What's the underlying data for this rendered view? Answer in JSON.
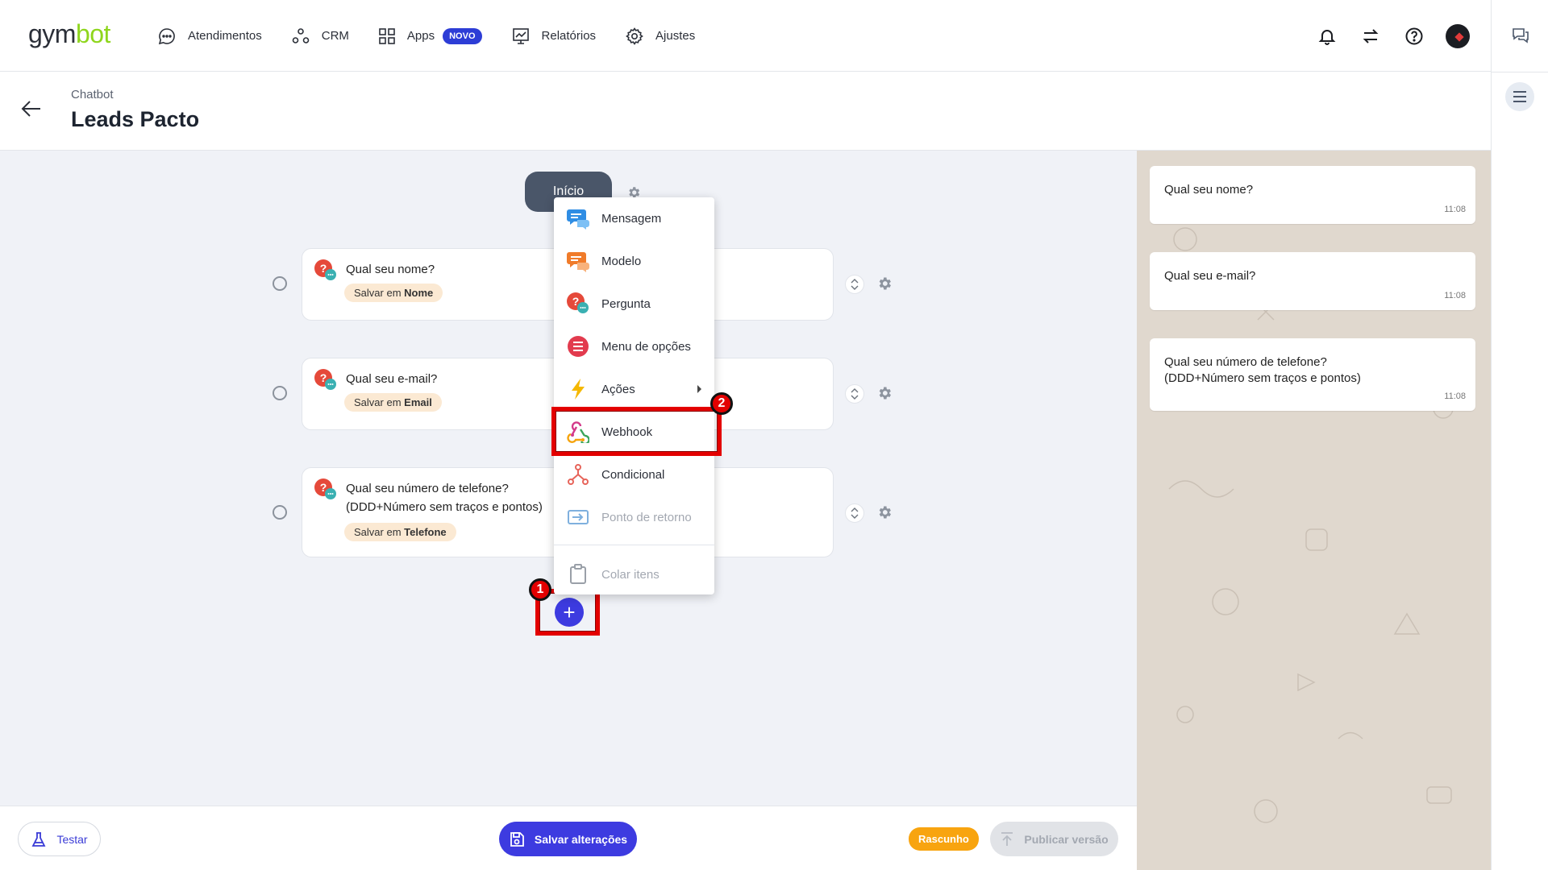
{
  "app": {
    "logo_gym": "gym",
    "logo_bot": "bot"
  },
  "nav": {
    "items": [
      {
        "label": "Atendimentos",
        "icon": "chat-bubble-icon"
      },
      {
        "label": "CRM",
        "icon": "crm-nodes-icon"
      },
      {
        "label": "Apps",
        "icon": "apps-grid-icon",
        "badge": "NOVO"
      },
      {
        "label": "Relatórios",
        "icon": "chart-board-icon"
      },
      {
        "label": "Ajustes",
        "icon": "gear-icon"
      }
    ]
  },
  "header": {
    "breadcrumb": "Chatbot",
    "title": "Leads Pacto"
  },
  "flow": {
    "start_label": "Início",
    "cards": [
      {
        "question": "Qual seu nome?",
        "save_prefix": "Salvar em",
        "save_field": "Nome"
      },
      {
        "question": "Qual seu e-mail?",
        "save_prefix": "Salvar em",
        "save_field": "Email"
      },
      {
        "question_line1": "Qual seu número de telefone?",
        "question_line2": "(DDD+Número sem traços e pontos)",
        "save_prefix": "Salvar em",
        "save_field": "Telefone"
      }
    ],
    "add_symbol": "+"
  },
  "menu": {
    "items": [
      {
        "label": "Mensagem",
        "icon": "message-icon",
        "color": "#2f8de4"
      },
      {
        "label": "Modelo",
        "icon": "template-icon",
        "color": "#f07b2a"
      },
      {
        "label": "Pergunta",
        "icon": "question-icon",
        "color": "#e5493a"
      },
      {
        "label": "Menu de opções",
        "icon": "list-menu-icon",
        "color": "#e23b4e"
      },
      {
        "label": "Ações",
        "icon": "lightning-icon",
        "color": "#f5b800"
      },
      {
        "label": "Webhook",
        "icon": "webhook-icon",
        "color": "#d33a8a"
      },
      {
        "label": "Condicional",
        "icon": "branch-icon",
        "color": "#e7645a"
      },
      {
        "label": "Ponto de retorno",
        "icon": "return-point-icon",
        "color": "#7fb0de"
      },
      {
        "label": "Colar itens",
        "icon": "clipboard-icon",
        "color": "#9aa0a8"
      }
    ]
  },
  "annotations": {
    "step1": "1",
    "step2": "2"
  },
  "footer": {
    "test_label": "Testar",
    "save_label": "Salvar alterações",
    "status_badge": "Rascunho",
    "publish_label": "Publicar versão"
  },
  "preview": {
    "messages": [
      {
        "text": "Qual seu nome?",
        "time": "11:08"
      },
      {
        "text": "Qual seu e-mail?",
        "time": "11:08"
      },
      {
        "line1": "Qual seu número de telefone?",
        "line2": "(DDD+Número sem traços e pontos)",
        "time": "11:08"
      }
    ]
  },
  "colors": {
    "primary": "#3d3be0",
    "highlight": "#e30000",
    "draft": "#f8a40f",
    "logo_accent": "#8fd61e"
  }
}
